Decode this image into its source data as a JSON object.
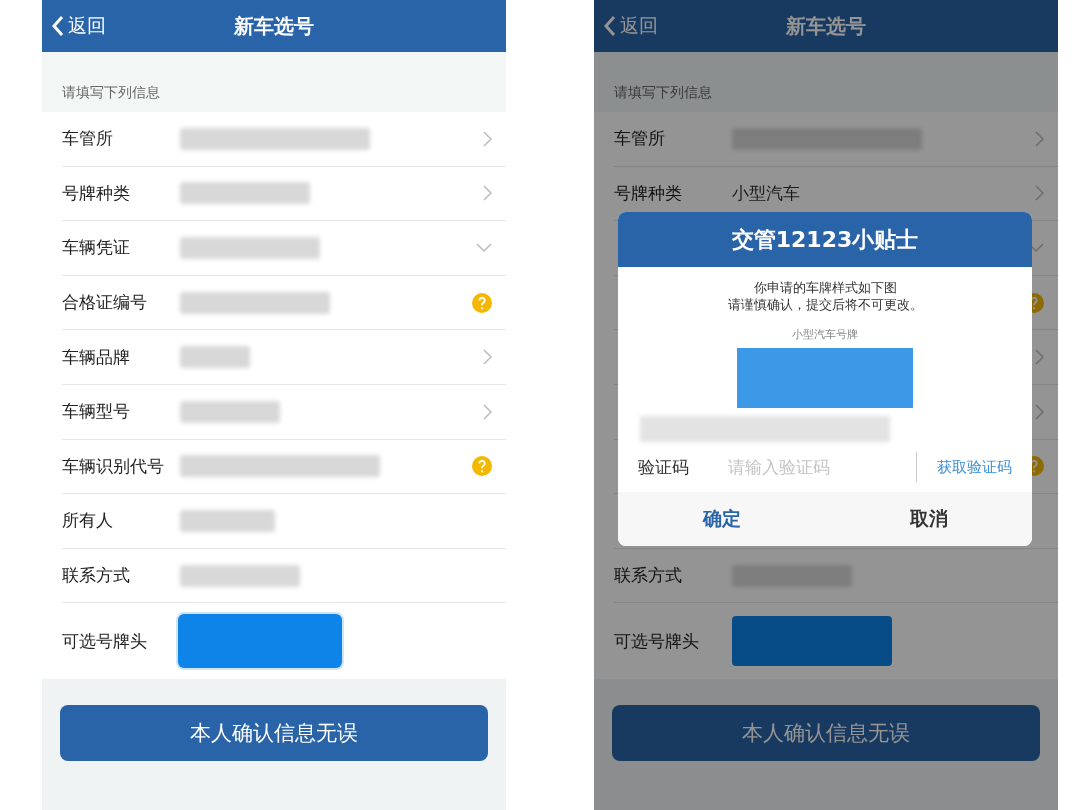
{
  "screens": [
    {
      "header": {
        "back": "返回",
        "title": "新车选号"
      },
      "section_label": "请填写下列信息",
      "dimmed": false,
      "rows": [
        {
          "kind": "chevron",
          "label": "车管所",
          "redacted": true
        },
        {
          "kind": "chevron",
          "label": "号牌种类",
          "redacted": true
        },
        {
          "kind": "dropdown",
          "label": "车辆凭证",
          "redacted": true
        },
        {
          "kind": "help",
          "label": "合格证编号",
          "redacted": true
        },
        {
          "kind": "chevron",
          "label": "车辆品牌",
          "redacted": true
        },
        {
          "kind": "chevron",
          "label": "车辆型号",
          "redacted": true
        },
        {
          "kind": "help",
          "label": "车辆识别代号",
          "redacted": true
        },
        {
          "kind": "plain",
          "label": "所有人",
          "redacted": true
        },
        {
          "kind": "plain",
          "label": "联系方式",
          "redacted": true
        },
        {
          "kind": "plate",
          "label": "可选号牌头",
          "selected": true
        }
      ],
      "confirm_button": "本人确认信息无误"
    },
    {
      "header": {
        "back": "返回",
        "title": "新车选号"
      },
      "section_label": "请填写下列信息",
      "dimmed": true,
      "rows": [
        {
          "kind": "chevron",
          "label": "车管所",
          "redacted": true
        },
        {
          "kind": "chevron",
          "label": "号牌种类",
          "value": "小型汽车"
        },
        {
          "kind": "dropdown"
        },
        {
          "kind": "help"
        },
        {
          "kind": "chevron"
        },
        {
          "kind": "chevron"
        },
        {
          "kind": "help"
        },
        {
          "kind": "plain"
        },
        {
          "kind": "plain",
          "label": "联系方式",
          "redacted": true
        },
        {
          "kind": "plate",
          "label": "可选号牌头",
          "selected": false
        }
      ],
      "confirm_button": "本人确认信息无误",
      "dialog": {
        "title": "交管12123小贴士",
        "message": [
          "你申请的车牌样式如下图",
          "请谨慎确认，提交后将不可更改。"
        ],
        "plate_caption": "小型汽车号牌",
        "code_label": "验证码",
        "code_placeholder": "请输入验证码",
        "get_code": "获取验证码",
        "buttons": [
          {
            "label": "确定",
            "kind": "primary"
          },
          {
            "label": "取消",
            "kind": "secondary"
          }
        ]
      }
    }
  ]
}
